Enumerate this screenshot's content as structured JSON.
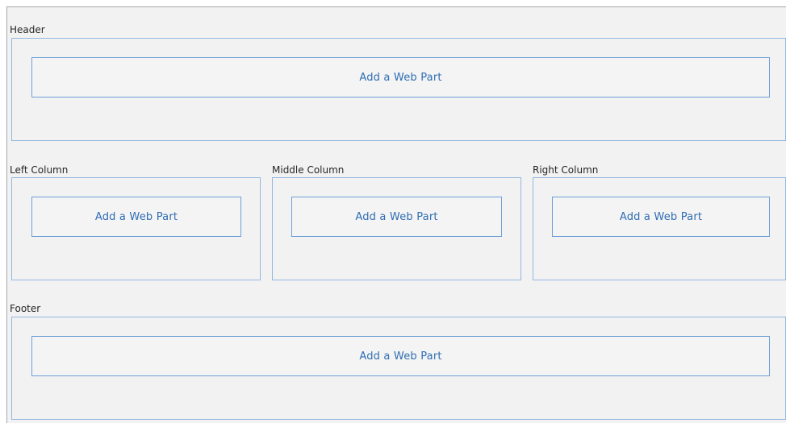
{
  "zones": {
    "header": {
      "label": "Header",
      "add_label": "Add a Web Part"
    },
    "left": {
      "label": "Left Column",
      "add_label": "Add a Web Part"
    },
    "middle": {
      "label": "Middle Column",
      "add_label": "Add a Web Part"
    },
    "right": {
      "label": "Right Column",
      "add_label": "Add a Web Part"
    },
    "footer": {
      "label": "Footer",
      "add_label": "Add a Web Part"
    }
  },
  "colors": {
    "canvas_background": "#f2f2f2",
    "zone_border": "#94b7e1",
    "button_border": "#6f9fd8",
    "link_text": "#2f6db3"
  }
}
